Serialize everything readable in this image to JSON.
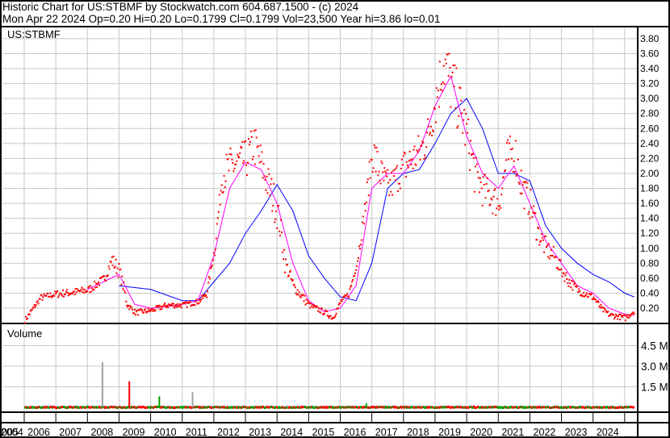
{
  "header": {
    "title": "Historic Chart for US:STBMF by Stockwatch.com 604.687.1500 - (c) 2024",
    "quote": "Mon Apr 22 2024  Op=0.20  Hi=0.20  Lo=0.1799  Cl=0.1799  Vol=23,500  Year hi=3.86  lo=0.01"
  },
  "chart_data": [
    {
      "type": "scatter",
      "title": "US:STBMF",
      "ylim": [
        0,
        3.9
      ],
      "y_ticks": [
        "0.20",
        "0.40",
        "0.60",
        "0.80",
        "1.00",
        "1.20",
        "1.40",
        "1.60",
        "1.80",
        "2.00",
        "2.20",
        "2.40",
        "2.60",
        "2.80",
        "3.00",
        "3.20",
        "3.40",
        "3.60",
        "3.80"
      ],
      "x_ticks": [
        "2004",
        "2005",
        "2006",
        "2007",
        "2008",
        "2009",
        "2010",
        "2011",
        "2012",
        "2013",
        "2014",
        "2015",
        "2016",
        "2017",
        "2018",
        "2019",
        "2020",
        "2021",
        "2022",
        "2023",
        "2024"
      ],
      "colors": {
        "price": "#ff0000",
        "ma_short": "#ff00ff",
        "ma_long": "#0000ff"
      },
      "price": [
        [
          2005.0,
          0.05
        ],
        [
          2005.5,
          0.35
        ],
        [
          2006.0,
          0.4
        ],
        [
          2006.5,
          0.42
        ],
        [
          2007.0,
          0.45
        ],
        [
          2007.5,
          0.6
        ],
        [
          2007.75,
          0.85
        ],
        [
          2008.0,
          0.7
        ],
        [
          2008.25,
          0.25
        ],
        [
          2008.5,
          0.15
        ],
        [
          2009.0,
          0.18
        ],
        [
          2009.5,
          0.25
        ],
        [
          2010.0,
          0.25
        ],
        [
          2010.5,
          0.3
        ],
        [
          2010.75,
          0.4
        ],
        [
          2011.0,
          1.0
        ],
        [
          2011.25,
          2.0
        ],
        [
          2011.5,
          2.1
        ],
        [
          2012.0,
          2.2
        ],
        [
          2012.25,
          2.4
        ],
        [
          2012.5,
          2.1
        ],
        [
          2013.0,
          1.5
        ],
        [
          2013.25,
          0.8
        ],
        [
          2013.5,
          0.5
        ],
        [
          2014.0,
          0.25
        ],
        [
          2014.5,
          0.15
        ],
        [
          2014.75,
          0.08
        ],
        [
          2015.0,
          0.3
        ],
        [
          2015.25,
          0.4
        ],
        [
          2015.5,
          0.8
        ],
        [
          2015.75,
          1.5
        ],
        [
          2016.0,
          2.3
        ],
        [
          2016.25,
          2.0
        ],
        [
          2016.5,
          1.8
        ],
        [
          2017.0,
          2.1
        ],
        [
          2017.5,
          2.3
        ],
        [
          2017.75,
          2.5
        ],
        [
          2018.0,
          3.0
        ],
        [
          2018.25,
          3.5
        ],
        [
          2018.5,
          3.2
        ],
        [
          2018.75,
          2.9
        ],
        [
          2019.0,
          2.5
        ],
        [
          2019.25,
          2.0
        ],
        [
          2019.5,
          1.8
        ],
        [
          2020.0,
          1.6
        ],
        [
          2020.25,
          2.2
        ],
        [
          2020.5,
          2.3
        ],
        [
          2020.75,
          1.8
        ],
        [
          2021.0,
          1.6
        ],
        [
          2021.25,
          1.2
        ],
        [
          2021.5,
          1.0
        ],
        [
          2021.75,
          0.9
        ],
        [
          2022.0,
          0.7
        ],
        [
          2022.25,
          0.55
        ],
        [
          2022.5,
          0.45
        ],
        [
          2022.75,
          0.4
        ],
        [
          2023.0,
          0.35
        ],
        [
          2023.25,
          0.2
        ],
        [
          2023.5,
          0.12
        ],
        [
          2023.75,
          0.1
        ],
        [
          2024.0,
          0.08
        ],
        [
          2024.3,
          0.18
        ]
      ],
      "ma_short": [
        [
          2007.0,
          0.45
        ],
        [
          2007.5,
          0.55
        ],
        [
          2008.0,
          0.65
        ],
        [
          2008.5,
          0.25
        ],
        [
          2009.0,
          0.2
        ],
        [
          2009.5,
          0.22
        ],
        [
          2010.0,
          0.25
        ],
        [
          2010.5,
          0.3
        ],
        [
          2011.0,
          0.9
        ],
        [
          2011.5,
          1.8
        ],
        [
          2012.0,
          2.15
        ],
        [
          2012.5,
          2.05
        ],
        [
          2013.0,
          1.6
        ],
        [
          2013.5,
          0.8
        ],
        [
          2014.0,
          0.3
        ],
        [
          2014.5,
          0.15
        ],
        [
          2015.0,
          0.2
        ],
        [
          2015.5,
          0.5
        ],
        [
          2016.0,
          1.8
        ],
        [
          2016.5,
          2.0
        ],
        [
          2017.0,
          2.0
        ],
        [
          2017.5,
          2.3
        ],
        [
          2018.0,
          2.9
        ],
        [
          2018.5,
          3.3
        ],
        [
          2019.0,
          2.5
        ],
        [
          2019.5,
          2.0
        ],
        [
          2020.0,
          1.8
        ],
        [
          2020.5,
          2.1
        ],
        [
          2021.0,
          1.6
        ],
        [
          2021.5,
          1.1
        ],
        [
          2022.0,
          0.8
        ],
        [
          2022.5,
          0.5
        ],
        [
          2023.0,
          0.4
        ],
        [
          2023.5,
          0.2
        ],
        [
          2024.0,
          0.12
        ],
        [
          2024.3,
          0.1
        ]
      ],
      "ma_long": [
        [
          2008.0,
          0.5
        ],
        [
          2009.0,
          0.45
        ],
        [
          2010.0,
          0.3
        ],
        [
          2010.5,
          0.3
        ],
        [
          2011.0,
          0.55
        ],
        [
          2011.5,
          0.8
        ],
        [
          2012.0,
          1.2
        ],
        [
          2012.5,
          1.5
        ],
        [
          2013.0,
          1.85
        ],
        [
          2013.5,
          1.5
        ],
        [
          2014.0,
          0.9
        ],
        [
          2014.5,
          0.6
        ],
        [
          2015.0,
          0.35
        ],
        [
          2015.5,
          0.3
        ],
        [
          2016.0,
          0.8
        ],
        [
          2016.5,
          1.8
        ],
        [
          2017.0,
          2.0
        ],
        [
          2017.5,
          2.05
        ],
        [
          2018.0,
          2.4
        ],
        [
          2018.5,
          2.8
        ],
        [
          2019.0,
          3.0
        ],
        [
          2019.5,
          2.6
        ],
        [
          2020.0,
          2.0
        ],
        [
          2020.5,
          2.0
        ],
        [
          2021.0,
          1.9
        ],
        [
          2021.5,
          1.3
        ],
        [
          2022.0,
          1.0
        ],
        [
          2022.5,
          0.8
        ],
        [
          2023.0,
          0.65
        ],
        [
          2023.5,
          0.55
        ],
        [
          2024.0,
          0.4
        ],
        [
          2024.3,
          0.35
        ]
      ]
    },
    {
      "type": "bar",
      "title": "Volume",
      "ylim": [
        0,
        5.5
      ],
      "unit": "M",
      "y_ticks": [
        "1.5 M",
        "3.0 M",
        "4.5 M"
      ],
      "spikes": [
        [
          2007.45,
          3.3,
          "#a0a0a0"
        ],
        [
          2008.3,
          1.9,
          "#ff0000"
        ],
        [
          2009.25,
          0.8,
          "#00a000"
        ],
        [
          2010.3,
          1.1,
          "#a0a0a0"
        ],
        [
          2015.8,
          0.3,
          "#00a000"
        ],
        [
          2013.3,
          0.15,
          "#a0a0a0"
        ],
        [
          2019.2,
          0.15,
          "#ff0000"
        ]
      ]
    }
  ]
}
